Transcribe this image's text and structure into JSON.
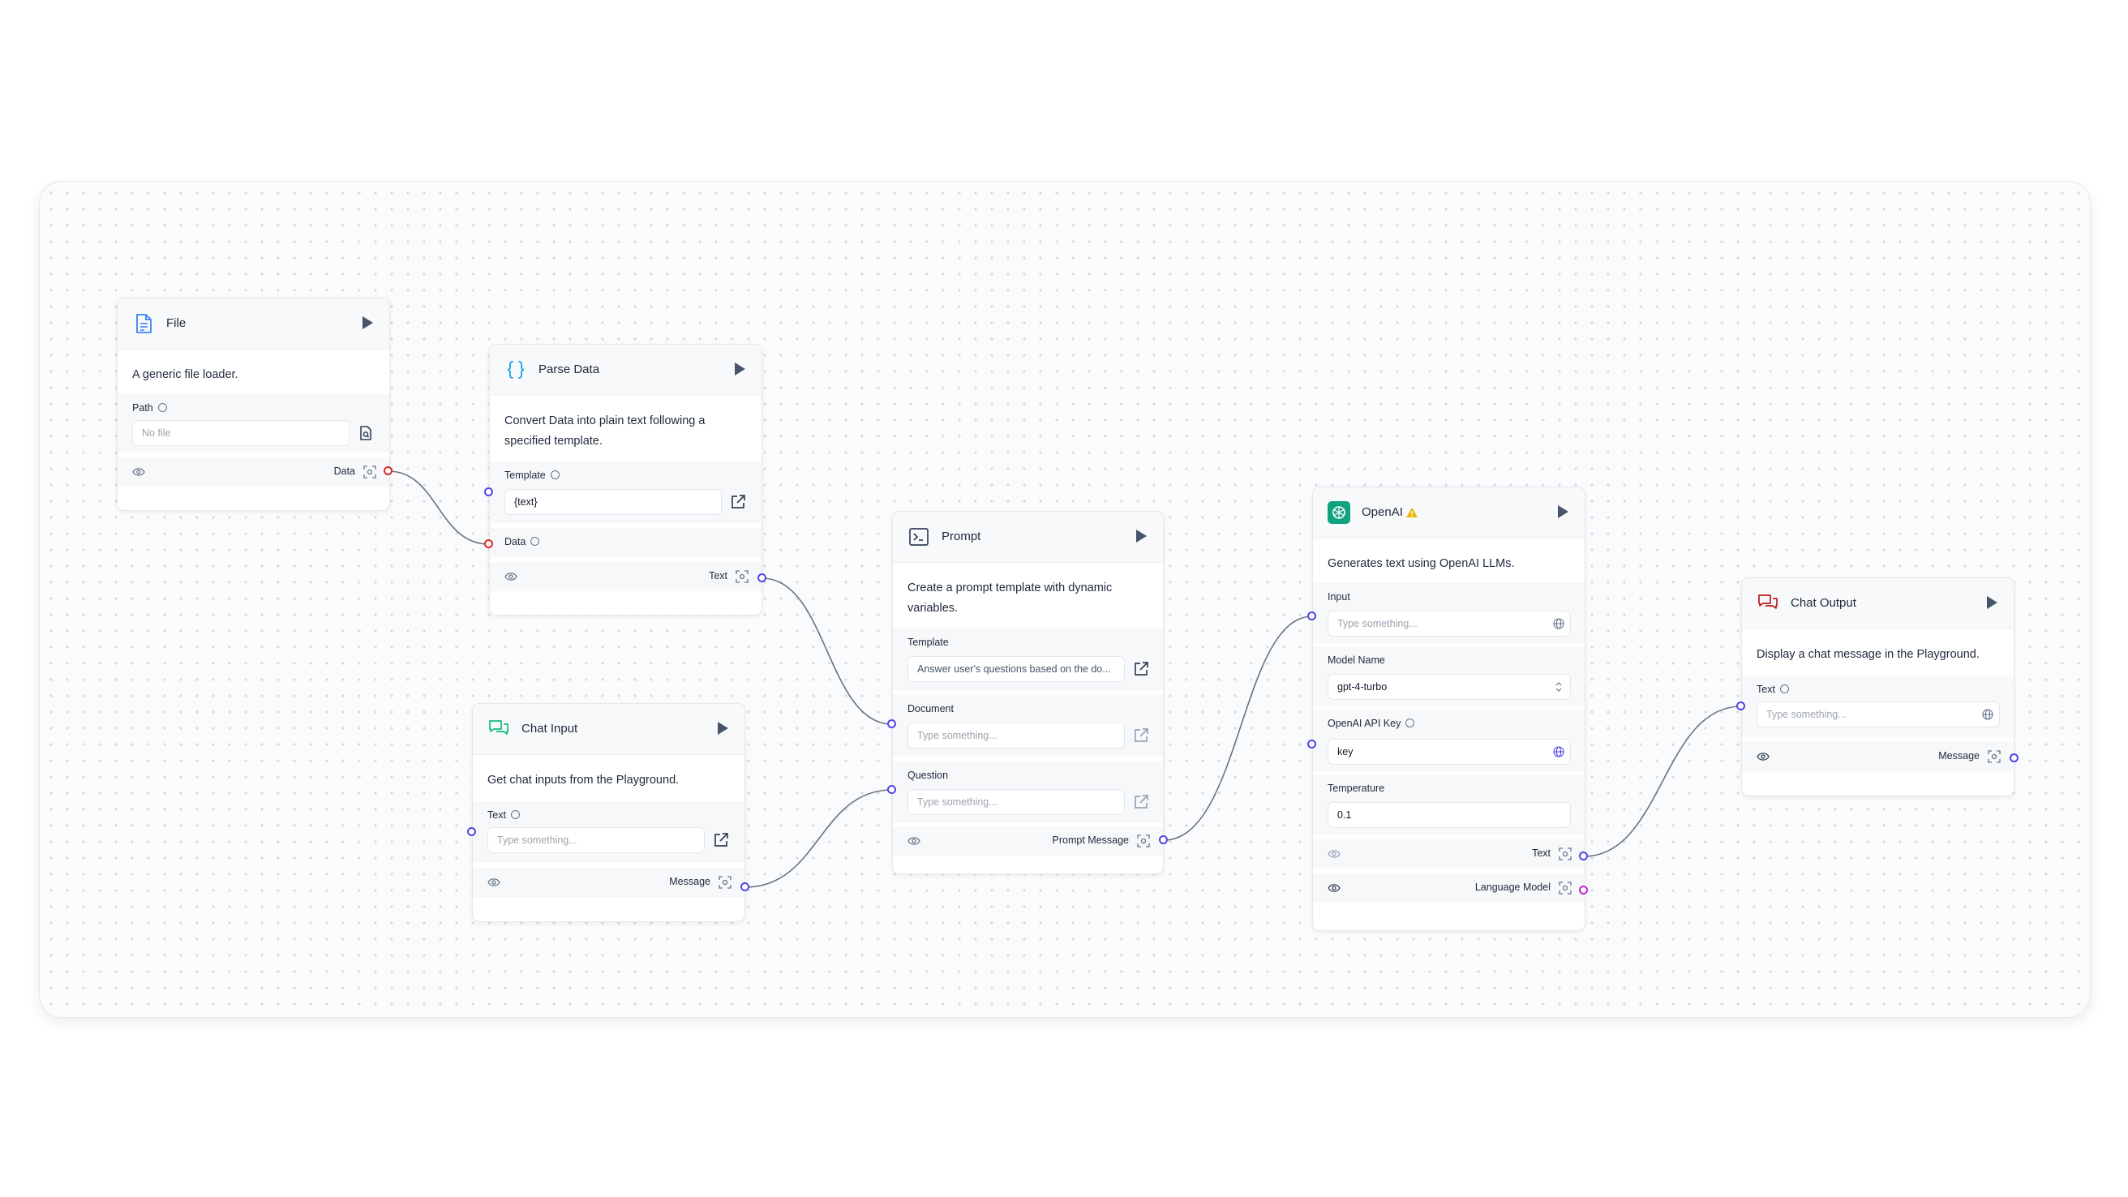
{
  "nodes": {
    "file": {
      "title": "File",
      "description": "A generic file loader.",
      "path_label": "Path",
      "path_placeholder": "No file",
      "output_label": "Data"
    },
    "parse_data": {
      "title": "Parse Data",
      "description_1": "Convert Data into plain text following a",
      "description_2": "specified template.",
      "template_label": "Template",
      "template_value": "{text}",
      "data_label": "Data",
      "output_label": "Text"
    },
    "chat_input": {
      "title": "Chat Input",
      "description": "Get chat inputs from the Playground.",
      "text_label": "Text",
      "text_placeholder": "Type something...",
      "output_label": "Message"
    },
    "prompt": {
      "title": "Prompt",
      "description_1": "Create a prompt template with dynamic",
      "description_2": "variables.",
      "template_label": "Template",
      "template_value": "Answer user's questions based on the do...",
      "document_label": "Document",
      "document_placeholder": "Type something...",
      "question_label": "Question",
      "question_placeholder": "Type something...",
      "output_label": "Prompt Message"
    },
    "openai": {
      "title": "OpenAI",
      "description": "Generates text using OpenAI LLMs.",
      "input_label": "Input",
      "input_placeholder": "Type something...",
      "model_label": "Model Name",
      "model_value": "gpt-4-turbo",
      "api_key_label": "OpenAI API Key",
      "api_key_value": "key",
      "temperature_label": "Temperature",
      "temperature_value": "0.1",
      "output_text_label": "Text",
      "output_lm_label": "Language Model"
    },
    "chat_output": {
      "title": "Chat Output",
      "description": "Display a chat message in the Playground.",
      "text_label": "Text",
      "text_placeholder": "Type something...",
      "output_label": "Message"
    }
  },
  "colors": {
    "edge": "#6b7280",
    "handle_default": "#4f46e5",
    "handle_data": "#dc2626",
    "handle_model": "#c026d3",
    "openai_brand": "#10a37f",
    "warning": "#eab308",
    "chat_input_icon": "#10b981",
    "chat_output_icon": "#b91c1c",
    "file_icon": "#3b82f6",
    "parse_icon": "#0ea5e9"
  }
}
